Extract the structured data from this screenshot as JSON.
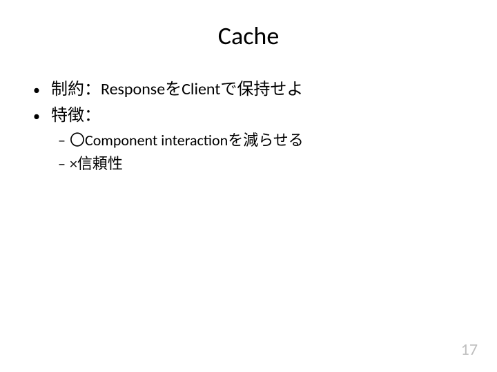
{
  "slide": {
    "title": "Cache",
    "bullets": [
      {
        "level": 1,
        "text": "制約：ResponseをClientで保持せよ"
      },
      {
        "level": 1,
        "text": "特徴："
      },
      {
        "level": 2,
        "text": "〇Component interactionを減らせる"
      },
      {
        "level": 2,
        "text": "×信頼性"
      }
    ],
    "page_number": "17"
  }
}
